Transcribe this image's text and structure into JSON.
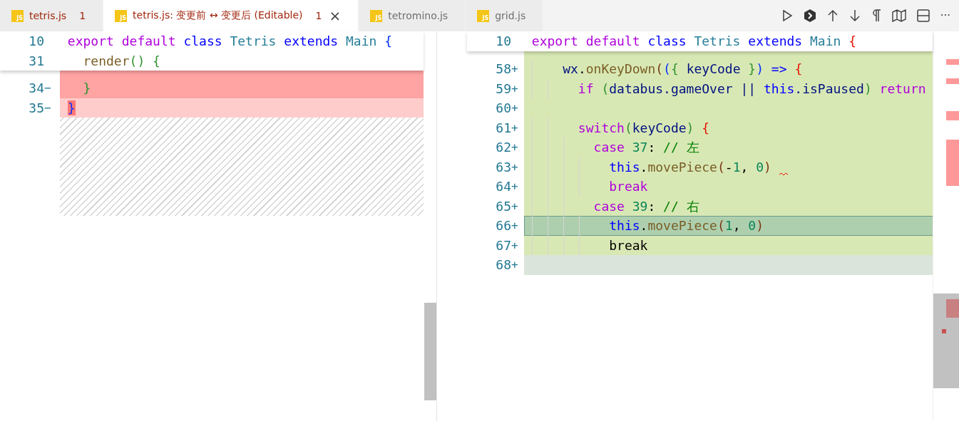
{
  "tabs": [
    {
      "label": "tetris.js",
      "file_icon": "JS",
      "badge": "1",
      "problem": true,
      "selected": false,
      "closable": false
    },
    {
      "label": "tetris.js: 变更前 ↔ 变更后 (Editable)",
      "file_icon": "JS",
      "badge": "1",
      "problem": true,
      "selected": true,
      "closable": true,
      "close_glyph": "×"
    },
    {
      "label": "tetromino.js",
      "file_icon": "JS",
      "problem": false,
      "selected": false,
      "closable": false
    },
    {
      "label": "grid.js",
      "file_icon": "JS",
      "problem": false,
      "selected": false,
      "closable": false
    }
  ],
  "toolbar_more": "···",
  "original": {
    "sticky": [
      {
        "number": "10",
        "tokens": [
          {
            "text": "export ",
            "kind": "kw"
          },
          {
            "text": "default ",
            "kind": "kw"
          },
          {
            "text": "class ",
            "kind": "storage"
          },
          {
            "text": "Tetris ",
            "kind": "type"
          },
          {
            "text": "extends ",
            "kind": "storage"
          },
          {
            "text": "Main ",
            "kind": "type"
          },
          {
            "text": "{",
            "kind": "b1"
          }
        ]
      },
      {
        "number": "31",
        "tokens": [
          {
            "text": "  render",
            "kind": "fn"
          },
          {
            "text": "() {",
            "kind": "b2"
          }
        ]
      }
    ],
    "lines": [
      {
        "number": "34",
        "sign": "−",
        "kind": "removed",
        "selected": false,
        "warning": false,
        "tokens": [
          {
            "text": "  }",
            "kind": "b2"
          }
        ]
      },
      {
        "number": "35",
        "sign": "−",
        "kind": "removed-light",
        "selected": false,
        "warning": false,
        "tokens": [
          {
            "text": "}",
            "kind": "b1",
            "changed": true
          }
        ]
      }
    ]
  },
  "modified": {
    "sticky": [
      {
        "number": "10",
        "tokens": [
          {
            "text": "export ",
            "kind": "kw"
          },
          {
            "text": "default ",
            "kind": "kw"
          },
          {
            "text": "class ",
            "kind": "storage"
          },
          {
            "text": "Tetris ",
            "kind": "type"
          },
          {
            "text": "extends ",
            "kind": "storage"
          },
          {
            "text": "Main ",
            "kind": "type"
          },
          {
            "text": "{",
            "kind": "err"
          }
        ]
      }
    ],
    "lines": [
      {
        "number": "58",
        "sign": "+",
        "kind": "added",
        "selected": false,
        "warning": false,
        "tokens": [
          {
            "text": "    wx",
            "kind": "var"
          },
          {
            "text": ".",
            "kind": "plain"
          },
          {
            "text": "onKeyDown",
            "kind": "fn"
          },
          {
            "text": "(",
            "kind": "b3"
          },
          {
            "text": "(",
            "kind": "b1"
          },
          {
            "text": "{",
            "kind": "b2"
          },
          {
            "text": " keyCode ",
            "kind": "var"
          },
          {
            "text": "}",
            "kind": "b2"
          },
          {
            "text": ")",
            "kind": "b1"
          },
          {
            "text": " => ",
            "kind": "storage"
          },
          {
            "text": "{",
            "kind": "err"
          }
        ]
      },
      {
        "number": "59",
        "sign": "+",
        "kind": "added",
        "selected": false,
        "warning": false,
        "tokens": [
          {
            "text": "      if ",
            "kind": "kw"
          },
          {
            "text": "(",
            "kind": "b2"
          },
          {
            "text": "databus.gameOver || ",
            "kind": "var"
          },
          {
            "text": "this",
            "kind": "storage"
          },
          {
            "text": ".isPaused",
            "kind": "var"
          },
          {
            "text": ")",
            "kind": "b2"
          },
          {
            "text": " return",
            "kind": "kw"
          }
        ]
      },
      {
        "number": "60",
        "sign": "+",
        "kind": "added",
        "selected": false,
        "warning": false
      },
      {
        "number": "61",
        "sign": "+",
        "kind": "added",
        "selected": false,
        "warning": false,
        "tokens": [
          {
            "text": "      switch",
            "kind": "kw"
          },
          {
            "text": "(",
            "kind": "b2"
          },
          {
            "text": "keyCode",
            "kind": "var"
          },
          {
            "text": ")",
            "kind": "b2"
          },
          {
            "text": " {",
            "kind": "err"
          }
        ]
      },
      {
        "number": "62",
        "sign": "+",
        "kind": "added",
        "selected": false,
        "warning": false,
        "tokens": [
          {
            "text": "        case ",
            "kind": "kw"
          },
          {
            "text": "37",
            "kind": "num"
          },
          {
            "text": ": ",
            "kind": "plain"
          },
          {
            "text": "// 左",
            "kind": "comment"
          }
        ]
      },
      {
        "number": "63",
        "sign": "+",
        "kind": "added",
        "selected": false,
        "warning": true,
        "tokens": [
          {
            "text": "          this",
            "kind": "storage"
          },
          {
            "text": ".",
            "kind": "plain"
          },
          {
            "text": "movePiece",
            "kind": "fn"
          },
          {
            "text": "(",
            "kind": "b3"
          },
          {
            "text": "-",
            "kind": "plain"
          },
          {
            "text": "1",
            "kind": "num"
          },
          {
            "text": ", ",
            "kind": "plain"
          },
          {
            "text": "0",
            "kind": "num"
          },
          {
            "text": ")",
            "kind": "b3"
          }
        ]
      },
      {
        "number": "64",
        "sign": "+",
        "kind": "added",
        "selected": false,
        "warning": false,
        "tokens": [
          {
            "text": "          break",
            "kind": "kw"
          }
        ]
      },
      {
        "number": "65",
        "sign": "+",
        "kind": "added",
        "selected": false,
        "warning": false,
        "tokens": [
          {
            "text": "        case ",
            "kind": "kw"
          },
          {
            "text": "39",
            "kind": "num"
          },
          {
            "text": ": ",
            "kind": "plain"
          },
          {
            "text": "// 右",
            "kind": "comment"
          }
        ]
      },
      {
        "number": "66",
        "sign": "+",
        "kind": "added",
        "selected": true,
        "warning": false,
        "tokens": [
          {
            "text": "          this",
            "kind": "storage"
          },
          {
            "text": ".",
            "kind": "plain"
          },
          {
            "text": "movePiece",
            "kind": "fn"
          },
          {
            "text": "(",
            "kind": "b3"
          },
          {
            "text": "1",
            "kind": "num"
          },
          {
            "text": ", ",
            "kind": "plain"
          },
          {
            "text": "0",
            "kind": "num"
          },
          {
            "text": ")",
            "kind": "b3"
          }
        ]
      },
      {
        "number": "67",
        "sign": "+",
        "kind": "added",
        "selected": false,
        "warning": false,
        "tokens": [
          {
            "text": "          break",
            "kind": "plain"
          }
        ]
      },
      {
        "number": "68",
        "sign": "+",
        "kind": "added-blank",
        "selected": false,
        "warning": false
      }
    ]
  }
}
